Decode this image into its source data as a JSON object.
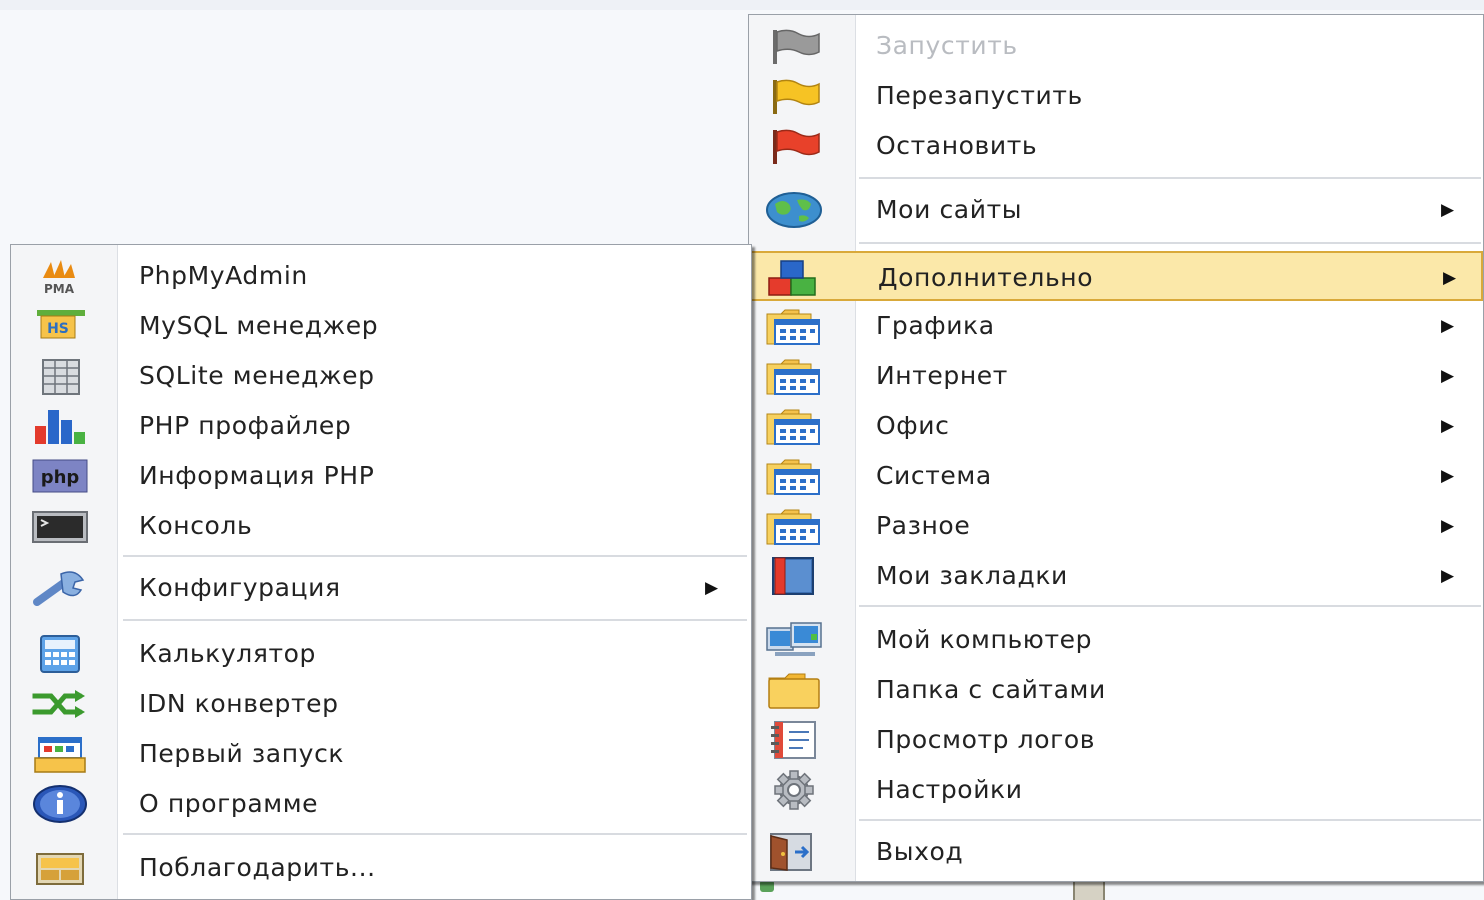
{
  "main_menu": {
    "items": [
      {
        "label": "Запустить",
        "icon": "flag-gray-icon",
        "disabled": true
      },
      {
        "label": "Перезапустить",
        "icon": "flag-yellow-icon"
      },
      {
        "label": "Остановить",
        "icon": "flag-red-icon"
      },
      {
        "label": "Мои сайты",
        "icon": "globe-icon",
        "submenu": true
      },
      {
        "label": "Дополнительно",
        "icon": "blocks-icon",
        "submenu": true,
        "highlighted": true
      },
      {
        "label": "Графика",
        "icon": "folder-apps-icon",
        "submenu": true
      },
      {
        "label": "Интернет",
        "icon": "folder-apps-icon",
        "submenu": true
      },
      {
        "label": "Офис",
        "icon": "folder-apps-icon",
        "submenu": true
      },
      {
        "label": "Система",
        "icon": "folder-apps-icon",
        "submenu": true
      },
      {
        "label": "Разное",
        "icon": "folder-apps-icon",
        "submenu": true
      },
      {
        "label": "Мои закладки",
        "icon": "bookmark-book-icon",
        "submenu": true
      },
      {
        "label": "Мой компьютер",
        "icon": "computer-icon"
      },
      {
        "label": "Папка с сайтами",
        "icon": "folder-icon"
      },
      {
        "label": "Просмотр логов",
        "icon": "log-notebook-icon"
      },
      {
        "label": "Настройки",
        "icon": "gear-icon"
      },
      {
        "label": "Выход",
        "icon": "exit-door-icon"
      }
    ]
  },
  "sub_menu": {
    "items": [
      {
        "label": "PhpMyAdmin",
        "icon": "phpmyadmin-icon",
        "icon_text": "PMA"
      },
      {
        "label": "MySQL менеджер",
        "icon": "heidisql-icon",
        "icon_text": "HS"
      },
      {
        "label": "SQLite менеджер",
        "icon": "database-icon"
      },
      {
        "label": "PHP профайлер",
        "icon": "bar-chart-icon"
      },
      {
        "label": "Информация PHP",
        "icon": "php-icon",
        "icon_text": "php"
      },
      {
        "label": "Консоль",
        "icon": "console-icon"
      },
      {
        "label": "Конфигурация",
        "icon": "wrench-icon",
        "submenu": true
      },
      {
        "label": "Калькулятор",
        "icon": "calculator-icon"
      },
      {
        "label": "IDN конвертер",
        "icon": "idn-convert-icon"
      },
      {
        "label": "Первый запуск",
        "icon": "first-run-icon"
      },
      {
        "label": "О программе",
        "icon": "info-icon"
      },
      {
        "label": "Поблагодарить...",
        "icon": "thanks-icon"
      }
    ]
  },
  "colors": {
    "highlight_bg": "#fbe8a9",
    "highlight_border": "#d9a93a",
    "disabled_text": "#b9bcc1"
  }
}
